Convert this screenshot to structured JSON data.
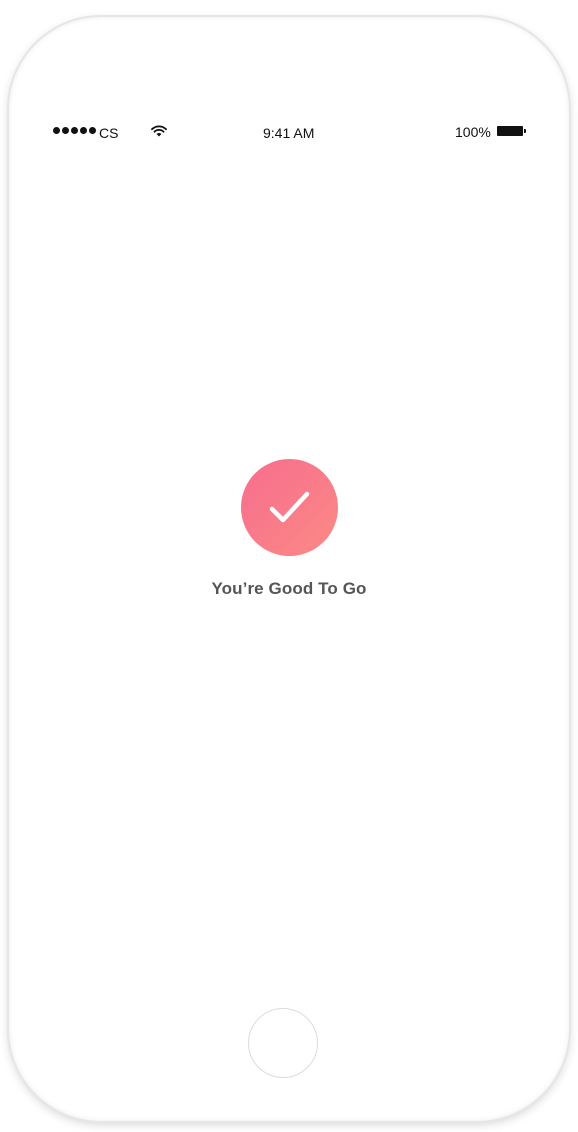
{
  "status_bar": {
    "carrier": "CS",
    "time": "9:41 AM",
    "battery_percent": "100%",
    "signal_bars": 5,
    "wifi_icon": "wifi-icon",
    "battery_icon": "battery-icon"
  },
  "success": {
    "icon": "checkmark-icon",
    "message": "You’re Good To Go",
    "gradient_start": "#f76d8e",
    "gradient_end": "#fb8a85"
  },
  "hardware": {
    "home_button": "home-button"
  }
}
